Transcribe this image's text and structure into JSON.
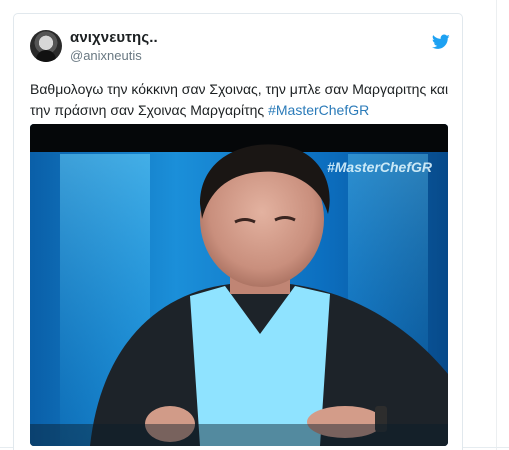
{
  "tweet": {
    "display_name": "ανιχνευτης..",
    "screen_name": "@anixneutis",
    "text_main": "Βαθμολογω την κόκκινη σαν Σχοινας, την μπλε σαν Μαργαριτης και την πράσινη σαν Σχοινας Μαργαρίτης ",
    "hashtag": "#MasterChefGR",
    "media_watermark": "#MasterChefGR"
  },
  "icons": {
    "brand": "twitter-bird-icon",
    "brand_color": "#1da1f2"
  },
  "colors": {
    "link": "#2b7bb9",
    "text": "#1c2022",
    "secondary": "#697882"
  }
}
